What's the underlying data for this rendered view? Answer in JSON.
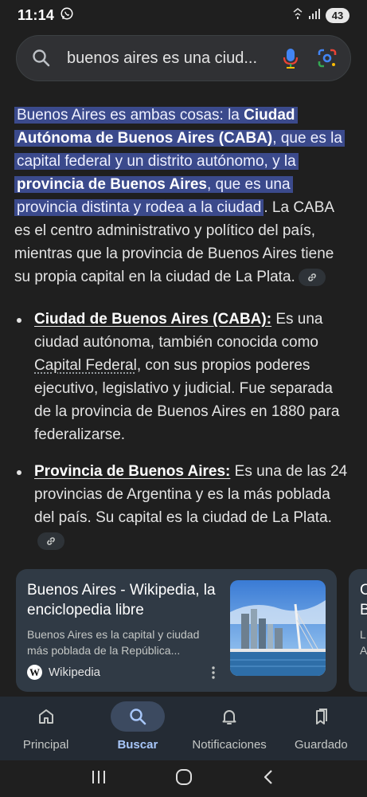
{
  "status_bar": {
    "time": "11:14",
    "battery": "43",
    "icons": [
      "whatsapp-icon",
      "wifi-icon",
      "signal-icon"
    ]
  },
  "search": {
    "query": "buenos aires es una ciud...",
    "icons": [
      "search-icon",
      "mic-icon",
      "lens-icon"
    ]
  },
  "answer": {
    "p1_hl_a": "Buenos Aires es ambas cosas: la ",
    "p1_hl_b": "Ciudad Autónoma de Buenos Aires (CABA)",
    "p1_hl_c": ", que es la capital federal y un distrito autónomo, y la ",
    "p1_hl_d": "provincia de Buenos Aires",
    "p1_hl_e": ", que es una provincia distinta y rodea a la ciudad",
    "p1_tail": ". La CABA es el centro administrativo y político del país, mientras que la provincia de Buenos Aires tiene su propia capital en la ciudad de La Plata."
  },
  "bullets": [
    {
      "term": "Ciudad de Buenos Aires (CABA):",
      "text_a": " Es una ciudad autónoma, también conocida como ",
      "link": "Capital Federal",
      "text_b": ", con sus propios poderes ejecutivo, legislativo y judicial. Fue separada de la provincia de Buenos Aires en 1880 para federalizarse."
    },
    {
      "term": "Provincia de Buenos Aires:",
      "text_a": " Es una de las 24 provincias de Argentina y es la más poblada del país. Su capital es la ciudad de La Plata."
    }
  ],
  "source_card": {
    "title": "Buenos Aires - Wikipedia, la enciclopedia libre",
    "snippet": "Buenos Aires es la capital y ciudad más poblada de la República...",
    "source": "Wikipedia",
    "logo": "W"
  },
  "peek_card": {
    "line1": "C",
    "line2": "B",
    "line3": "L",
    "line4": "A"
  },
  "bottom_nav": [
    {
      "label": "Principal",
      "icon": "home-icon"
    },
    {
      "label": "Buscar",
      "icon": "search-icon",
      "active": true
    },
    {
      "label": "Notificaciones",
      "icon": "bell-icon"
    },
    {
      "label": "Guardado",
      "icon": "bookmarks-icon"
    }
  ],
  "colors": {
    "background": "#1f1f1f",
    "highlight": "#3b4a8c",
    "card": "#303a45",
    "nav_active": "#a8c7fa"
  }
}
